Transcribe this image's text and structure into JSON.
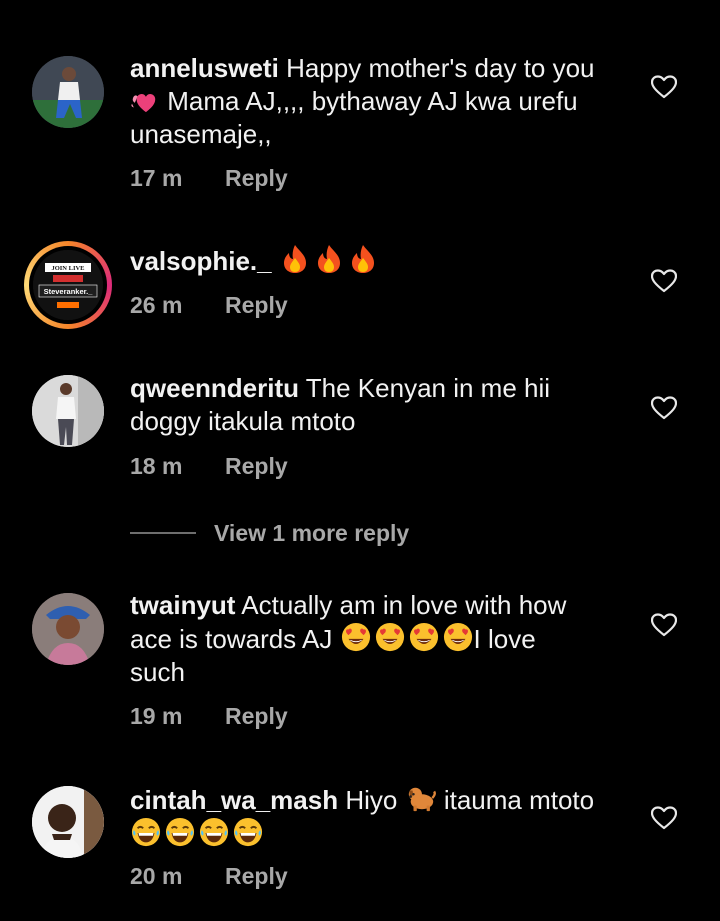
{
  "comments": [
    {
      "username": "annelusweti",
      "text_1": "Happy mother's day to you",
      "text_2": "Mama AJ,,,, bythaway AJ kwa urefu",
      "text_3": "unasemaje,,",
      "time": "17 m",
      "reply": "Reply",
      "emoji_1": "heart-emoji"
    },
    {
      "username": "valsophie._",
      "time": "26 m",
      "reply": "Reply",
      "emoji_1": "fire-emoji",
      "story_badge": {
        "line1": "JOIN LIVE",
        "line2": "Steveranker._"
      }
    },
    {
      "username": "qweennderitu",
      "text_1": "The Kenyan in me hii",
      "text_2": "doggy itakula mtoto",
      "time": "18 m",
      "reply": "Reply"
    },
    {
      "username": "twainyut",
      "text_1": "Actually am in love with how",
      "text_2": "ace is towards AJ",
      "text_2b": "I love",
      "text_3": "such",
      "time": "19 m",
      "reply": "Reply",
      "emoji_1": "heart-eyes-emoji"
    },
    {
      "username": "cintah_wa_mash",
      "text_1": "Hiyo",
      "text_1b": "itauma mtoto",
      "time": "20 m",
      "reply": "Reply",
      "emoji_1": "dog-emoji",
      "emoji_2": "laughing-emoji"
    }
  ],
  "view_more_label": "View 1 more reply",
  "colors": {
    "background": "#000000",
    "text": "#f2f2f2",
    "muted": "#a8a8a8"
  }
}
